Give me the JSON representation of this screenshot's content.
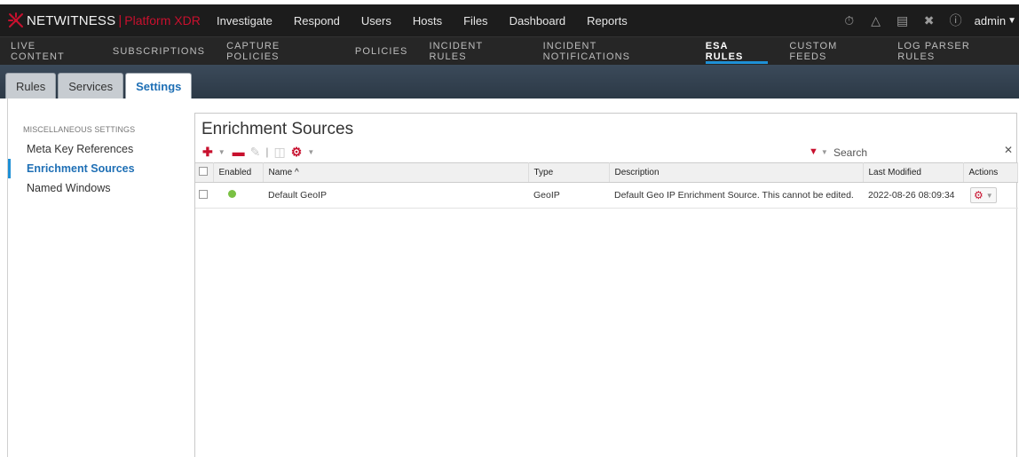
{
  "brand": {
    "name": "NETWITNESS",
    "product": "Platform XDR"
  },
  "topnav": [
    "Investigate",
    "Respond",
    "Users",
    "Hosts",
    "Files",
    "Dashboard",
    "Reports"
  ],
  "user": {
    "name": "admin"
  },
  "topicons": [
    "stopwatch-icon",
    "bell-icon",
    "notes-icon",
    "tools-icon",
    "help-icon"
  ],
  "subnav": {
    "items": [
      "LIVE CONTENT",
      "SUBSCRIPTIONS",
      "CAPTURE POLICIES",
      "POLICIES",
      "INCIDENT RULES",
      "INCIDENT NOTIFICATIONS",
      "ESA RULES",
      "CUSTOM FEEDS",
      "LOG PARSER RULES"
    ],
    "active": "ESA RULES"
  },
  "tabs": {
    "items": [
      "Rules",
      "Services",
      "Settings"
    ],
    "active": "Settings"
  },
  "sidebar": {
    "section": "MISCELLANEOUS SETTINGS",
    "items": [
      "Meta Key References",
      "Enrichment Sources",
      "Named Windows"
    ],
    "active": "Enrichment Sources"
  },
  "panel": {
    "title": "Enrichment Sources",
    "search_placeholder": "Search",
    "columns": [
      "Enabled",
      "Name ^",
      "Type",
      "Description",
      "Last Modified",
      "Actions"
    ],
    "rows": [
      {
        "enabled": true,
        "name": "Default GeoIP",
        "type": "GeoIP",
        "description": "Default Geo IP Enrichment Source. This cannot be edited.",
        "last_modified": "2022-08-26 08:09:34"
      }
    ]
  },
  "colors": {
    "accent": "#1e90d6",
    "brand_red": "#c8102e",
    "enabled_green": "#7ac143"
  }
}
